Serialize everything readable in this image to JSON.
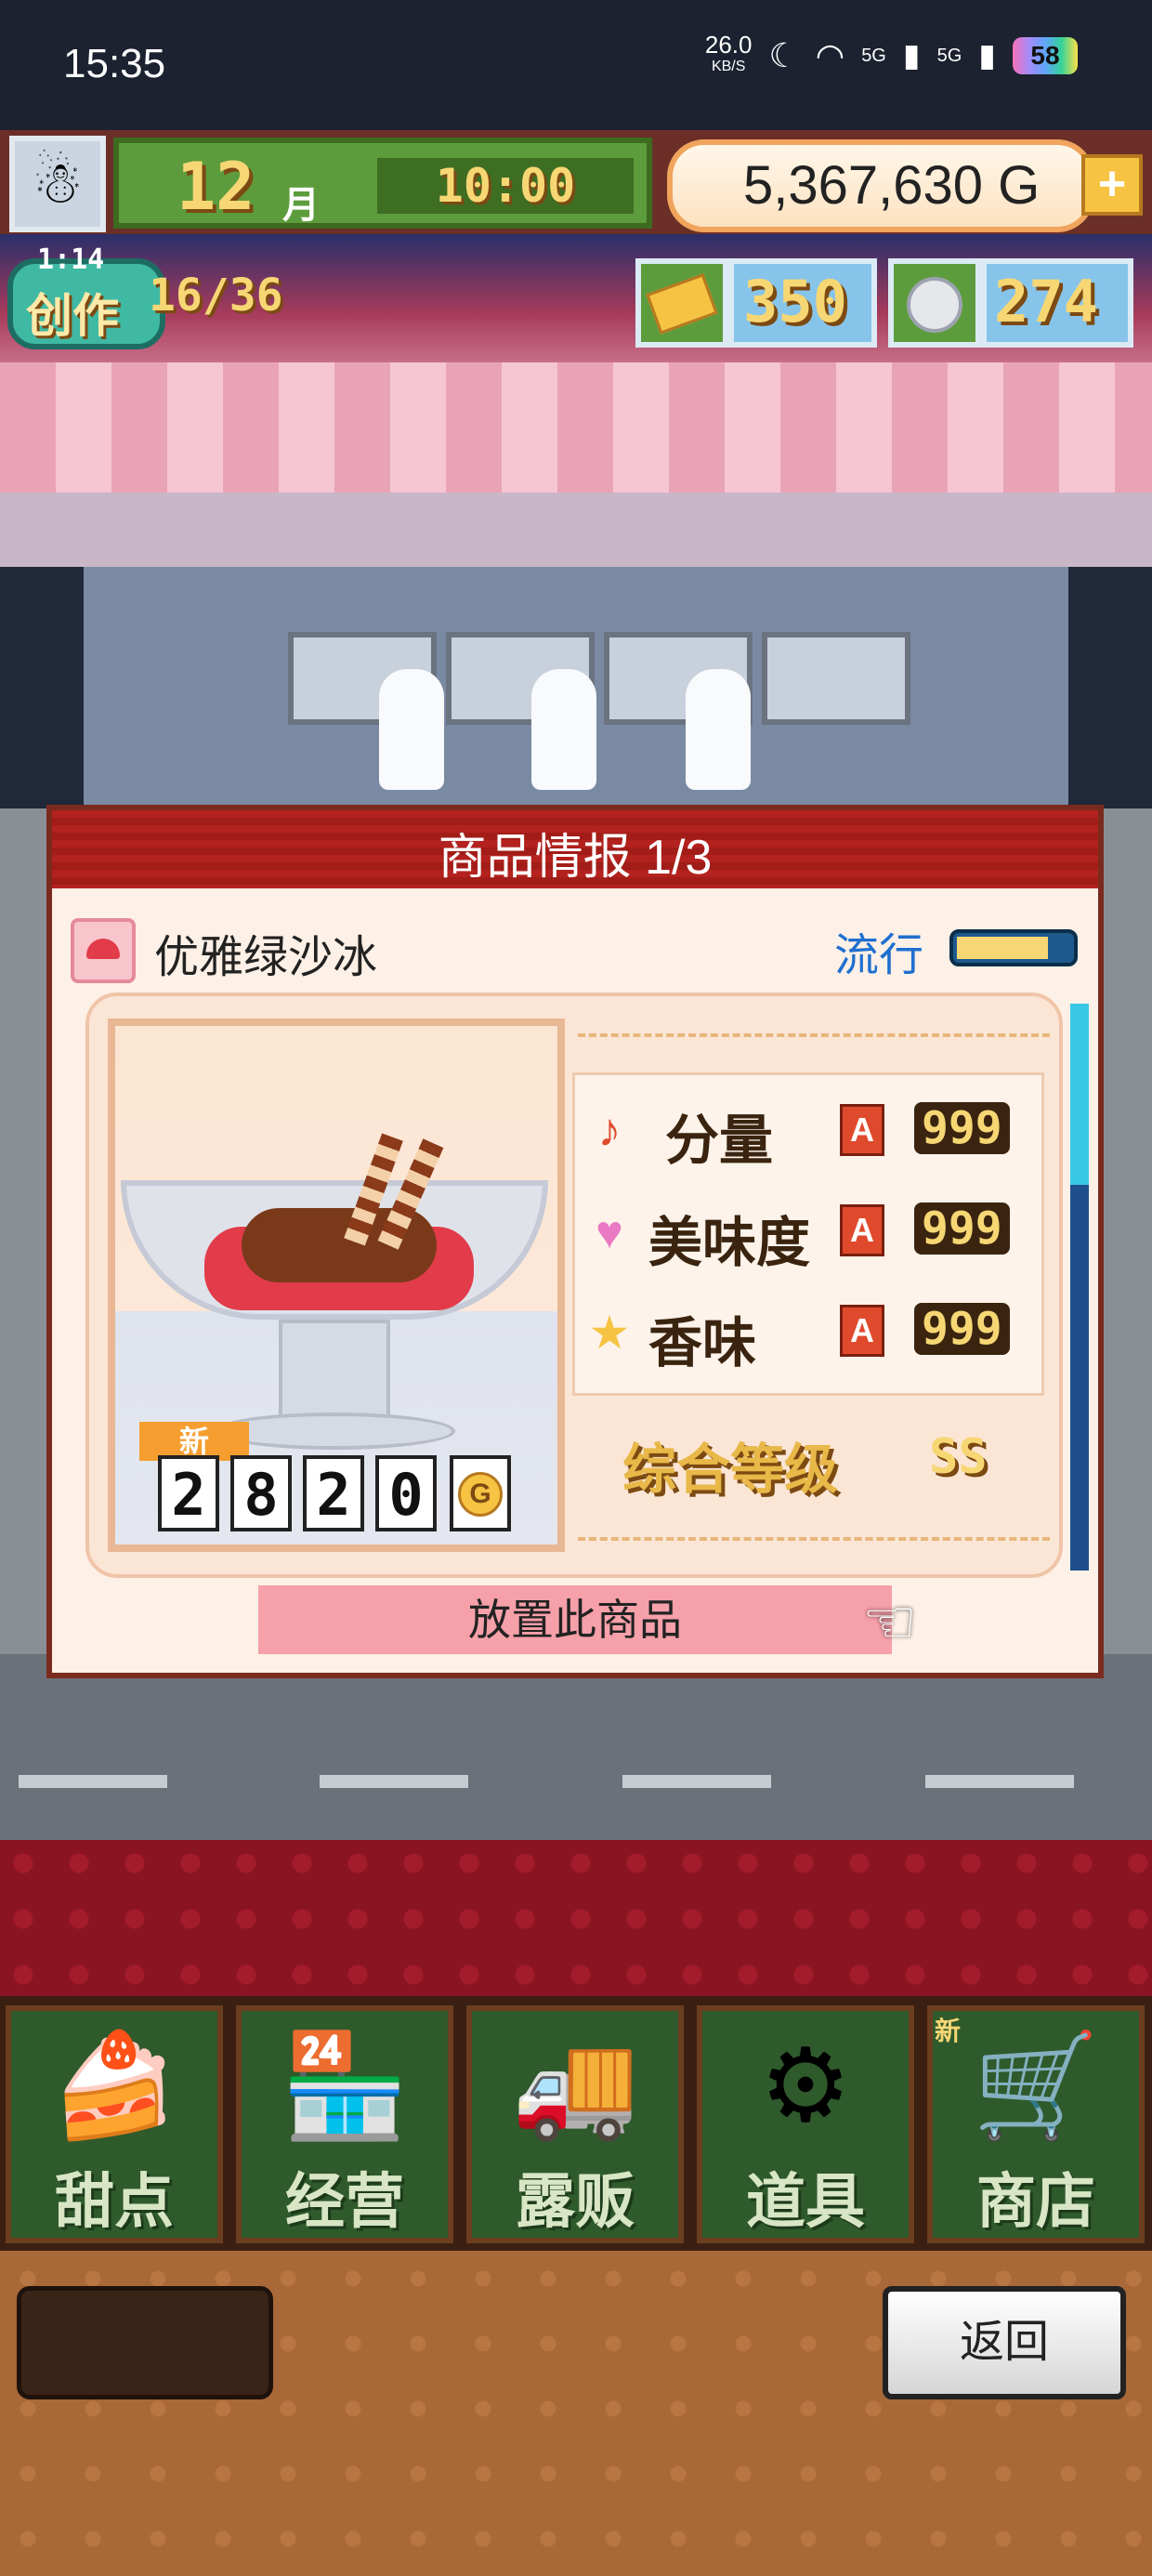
{
  "status_bar": {
    "time": "15:35",
    "net_speed": "26.0",
    "net_unit": "KB/S",
    "signal1": "5G",
    "signal2": "5G",
    "battery": "58"
  },
  "header": {
    "month_number": "12",
    "month_label": "月",
    "clock": "10:00",
    "gold": "5,367,630",
    "gold_unit": "G",
    "plus_label": "+"
  },
  "create": {
    "timer": "1:14",
    "label": "创作",
    "progress": "16/36"
  },
  "resources": {
    "ticket_count": "350",
    "medal_count": "274"
  },
  "dialog": {
    "title": "商品情报 1/3",
    "item_name": "优雅绿沙冰",
    "trend_label": "流行",
    "trend_level": 0.8,
    "new_tag": "新",
    "price_digits": [
      "2",
      "8",
      "2",
      "0"
    ],
    "price_unit": "G",
    "stats": [
      {
        "icon": "music-note-icon",
        "label": "分量",
        "rank": "A",
        "value": "999"
      },
      {
        "icon": "heart-icon",
        "label": "美味度",
        "rank": "A",
        "value": "999"
      },
      {
        "icon": "star-icon",
        "label": "香味",
        "rank": "A",
        "value": "999"
      }
    ],
    "overall_label": "综合等级",
    "overall_value": "SS",
    "place_button": "放置此商品"
  },
  "nav": {
    "items": [
      {
        "label": "甜点",
        "icon": "cake-icon"
      },
      {
        "label": "经营",
        "icon": "shop-icon"
      },
      {
        "label": "露贩",
        "icon": "food-truck-icon"
      },
      {
        "label": "道具",
        "icon": "tools-icon"
      },
      {
        "label": "商店",
        "icon": "cart-icon"
      }
    ],
    "new_badge": "新"
  },
  "back_button": "返回",
  "colors": {
    "title_red": "#b3221e",
    "trend_blue": "#1f6fd0",
    "nav_green": "#2f5a2c",
    "place_pink": "#f6a0aa"
  }
}
